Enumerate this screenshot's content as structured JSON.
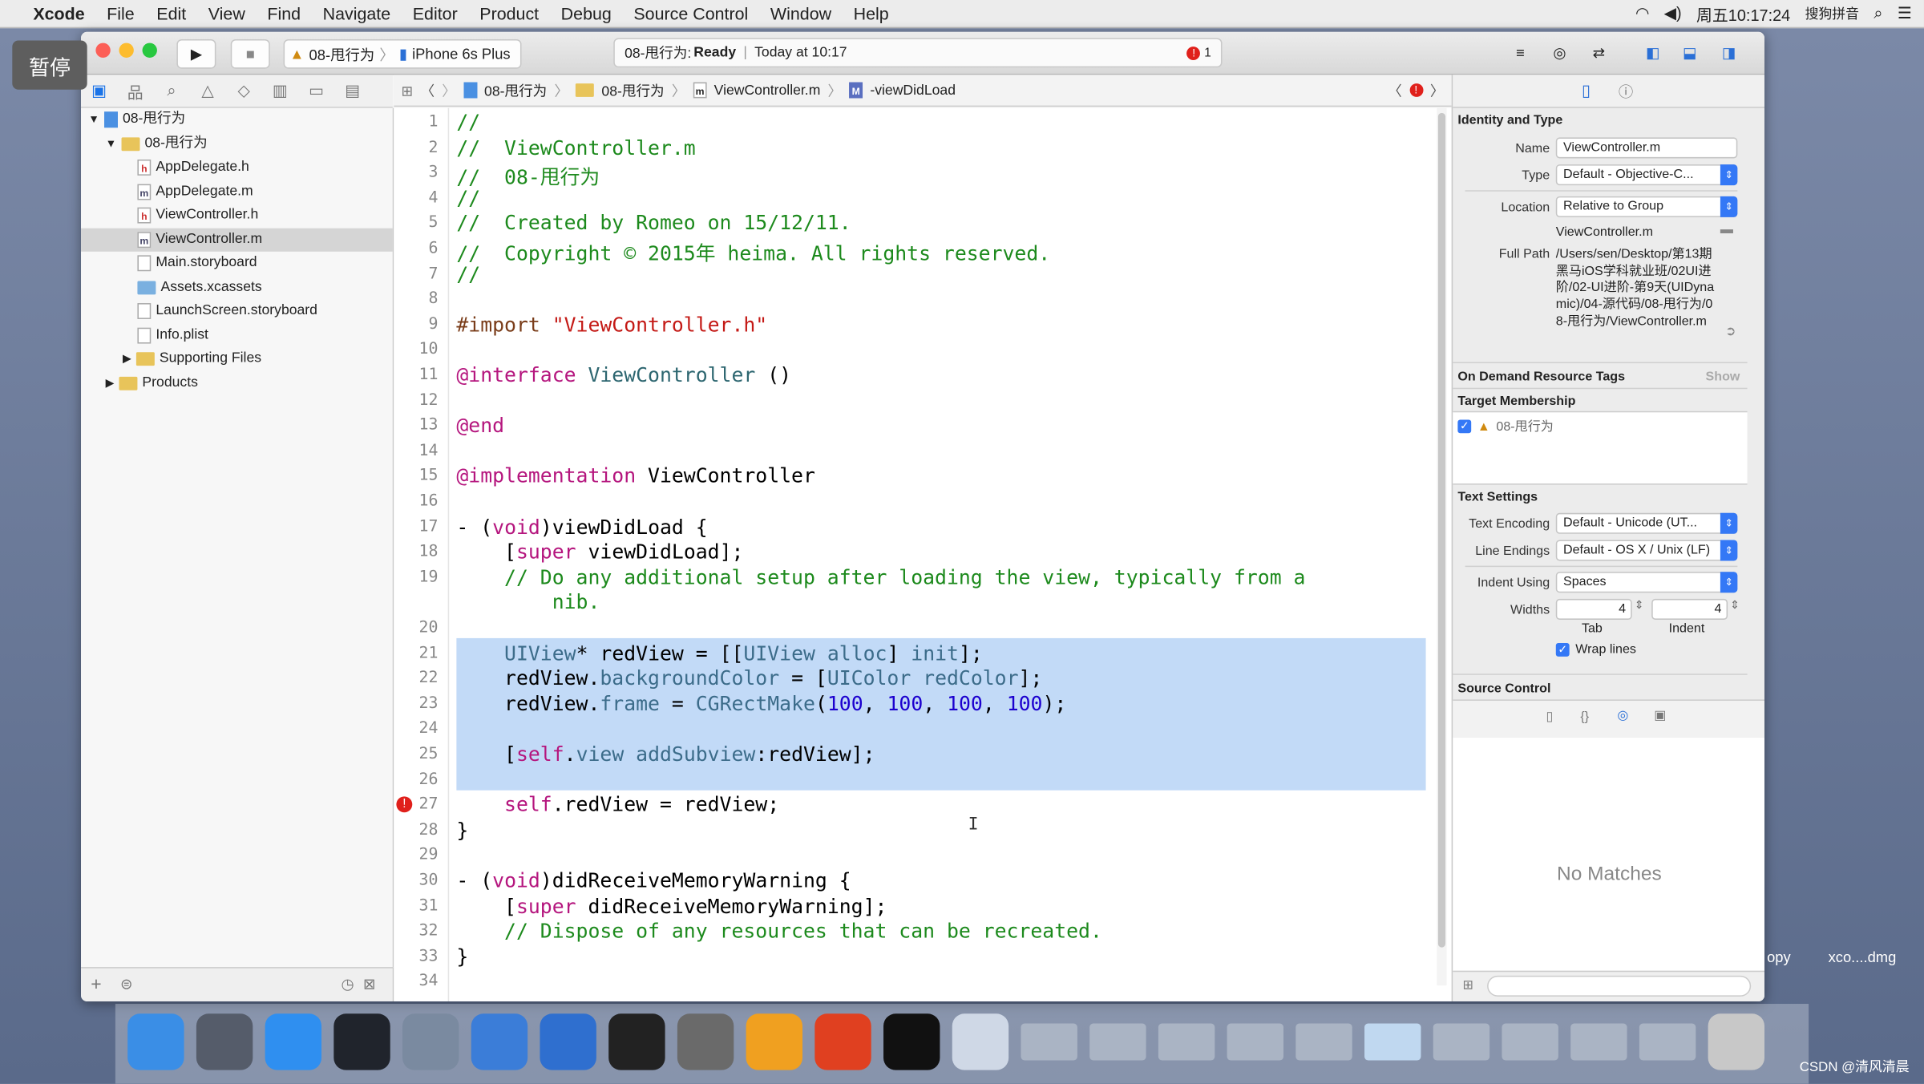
{
  "menubar": {
    "app": "Xcode",
    "items": [
      "File",
      "Edit",
      "View",
      "Find",
      "Navigate",
      "Editor",
      "Product",
      "Debug",
      "Source Control",
      "Window",
      "Help"
    ],
    "clock": "周五10:17:24",
    "input_method": "搜狗拼音"
  },
  "overlay": {
    "pause_label": "暂停"
  },
  "toolbar": {
    "scheme": "08-甩行为",
    "device": "iPhone 6s Plus",
    "activity_project": "08-甩行为:",
    "activity_status": "Ready",
    "activity_time": "Today at 10:17",
    "issue_count": "1"
  },
  "jumpbar": {
    "crumbs": [
      "08-甩行为",
      "08-甩行为",
      "ViewController.m",
      "-viewDidLoad"
    ]
  },
  "navigator": {
    "items": [
      {
        "label": "08-甩行为",
        "kind": "project"
      },
      {
        "label": "08-甩行为",
        "kind": "folder"
      },
      {
        "label": "AppDelegate.h",
        "kind": "h"
      },
      {
        "label": "AppDelegate.m",
        "kind": "m"
      },
      {
        "label": "ViewController.h",
        "kind": "h"
      },
      {
        "label": "ViewController.m",
        "kind": "m",
        "selected": true
      },
      {
        "label": "Main.storyboard",
        "kind": "sb"
      },
      {
        "label": "Assets.xcassets",
        "kind": "assets"
      },
      {
        "label": "LaunchScreen.storyboard",
        "kind": "sb"
      },
      {
        "label": "Info.plist",
        "kind": "plist"
      },
      {
        "label": "Supporting Files",
        "kind": "folder"
      },
      {
        "label": "Products",
        "kind": "folder"
      }
    ]
  },
  "editor": {
    "lines": [
      [
        [
          "//",
          "c"
        ]
      ],
      [
        [
          "//  ViewController.m",
          "c"
        ]
      ],
      [
        [
          "//  08-甩行为",
          "c"
        ]
      ],
      [
        [
          "//",
          "c"
        ]
      ],
      [
        [
          "//  Created by Romeo on 15/12/11.",
          "c"
        ]
      ],
      [
        [
          "//  Copyright © 2015年 heima. All rights reserved.",
          "c"
        ]
      ],
      [
        [
          "//",
          "c"
        ]
      ],
      [],
      [
        [
          "#import ",
          "p"
        ],
        [
          "\"ViewController.h\"",
          "s"
        ]
      ],
      [],
      [
        [
          "@interface ",
          "k"
        ],
        [
          "ViewController",
          "m"
        ],
        [
          " ()",
          "v"
        ]
      ],
      [],
      [
        [
          "@end",
          "k"
        ]
      ],
      [],
      [
        [
          "@implementation ",
          "k"
        ],
        [
          "ViewController",
          "v"
        ]
      ],
      [],
      [
        [
          "- (",
          "v"
        ],
        [
          "void",
          "k"
        ],
        [
          ")viewDidLoad {",
          "v"
        ]
      ],
      [
        [
          "    [",
          "v"
        ],
        [
          "super",
          "k"
        ],
        [
          " viewDidLoad];",
          "v"
        ]
      ],
      [
        [
          "    // Do any additional setup after loading the view, typically from a",
          "c"
        ]
      ],
      [
        [
          "        nib.",
          "c"
        ]
      ],
      [],
      [
        [
          "    ",
          "v"
        ],
        [
          "UIView",
          "t"
        ],
        [
          "* redView = [[",
          "v"
        ],
        [
          "UIView",
          "t"
        ],
        [
          " ",
          "v"
        ],
        [
          "alloc",
          "t"
        ],
        [
          "] ",
          "v"
        ],
        [
          "init",
          "t"
        ],
        [
          "];",
          "v"
        ]
      ],
      [
        [
          "    redView.",
          "v"
        ],
        [
          "backgroundColor",
          "t"
        ],
        [
          " = [",
          "v"
        ],
        [
          "UIColor",
          "t"
        ],
        [
          " ",
          "v"
        ],
        [
          "redColor",
          "t"
        ],
        [
          "];",
          "v"
        ]
      ],
      [
        [
          "    redView.",
          "v"
        ],
        [
          "frame",
          "t"
        ],
        [
          " = ",
          "v"
        ],
        [
          "CGRectMake",
          "t"
        ],
        [
          "(",
          "v"
        ],
        [
          "100",
          "n"
        ],
        [
          ", ",
          "v"
        ],
        [
          "100",
          "n"
        ],
        [
          ", ",
          "v"
        ],
        [
          "100",
          "n"
        ],
        [
          ", ",
          "v"
        ],
        [
          "100",
          "n"
        ],
        [
          ");",
          "v"
        ]
      ],
      [],
      [
        [
          "    [",
          "v"
        ],
        [
          "self",
          "k"
        ],
        [
          ".",
          "v"
        ],
        [
          "view",
          "t"
        ],
        [
          " ",
          "v"
        ],
        [
          "addSubview",
          "t"
        ],
        [
          ":redView];",
          "v"
        ]
      ],
      [],
      [
        [
          "    ",
          "v"
        ],
        [
          "self",
          "k"
        ],
        [
          ".redView = redView;",
          "v"
        ]
      ],
      [
        [
          "}",
          "v"
        ]
      ],
      [],
      [
        [
          "- (",
          "v"
        ],
        [
          "void",
          "k"
        ],
        [
          ")didReceiveMemoryWarning {",
          "v"
        ]
      ],
      [
        [
          "    [",
          "v"
        ],
        [
          "super",
          "k"
        ],
        [
          " didReceiveMemoryWarning];",
          "v"
        ]
      ],
      [
        [
          "    // Dispose of any resources that can be recreated.",
          "c"
        ]
      ],
      [
        [
          "}",
          "v"
        ]
      ],
      []
    ],
    "line_numbers": [
      "1",
      "2",
      "3",
      "4",
      "5",
      "6",
      "7",
      "8",
      "9",
      "10",
      "11",
      "12",
      "13",
      "14",
      "15",
      "16",
      "17",
      "18",
      "19",
      "",
      "20",
      "21",
      "22",
      "23",
      "24",
      "25",
      "26",
      "27",
      "28",
      "29",
      "30",
      "31",
      "32",
      "33",
      "34"
    ],
    "error_line": "27"
  },
  "inspector": {
    "identity_title": "Identity and Type",
    "name_label": "Name",
    "name_value": "ViewController.m",
    "type_label": "Type",
    "type_value": "Default - Objective-C...",
    "location_label": "Location",
    "location_value": "Relative to Group",
    "location_file": "ViewController.m",
    "fullpath_label": "Full Path",
    "fullpath_value": "/Users/sen/Desktop/第13期黑马iOS学科就业班/02UI进阶/02-UI进阶-第9天(UIDynamic)/04-源代码/08-甩行为/08-甩行为/ViewController.m",
    "odr_title": "On Demand Resource Tags",
    "odr_show": "Show",
    "target_title": "Target Membership",
    "target_name": "08-甩行为",
    "text_title": "Text Settings",
    "encoding_label": "Text Encoding",
    "encoding_value": "Default - Unicode (UT...",
    "endings_label": "Line Endings",
    "endings_value": "Default - OS X / Unix (LF)",
    "indent_label": "Indent Using",
    "indent_value": "Spaces",
    "widths_label": "Widths",
    "tab_value": "4",
    "indent_value_num": "4",
    "tab_label": "Tab",
    "indent_sub_label": "Indent",
    "wrap_label": "Wrap lines",
    "sc_title": "Source Control",
    "no_matches": "No Matches"
  },
  "background": {
    "copy_label": "opy",
    "dmg_label": "xco....dmg"
  },
  "watermark": "CSDN @清风清晨"
}
